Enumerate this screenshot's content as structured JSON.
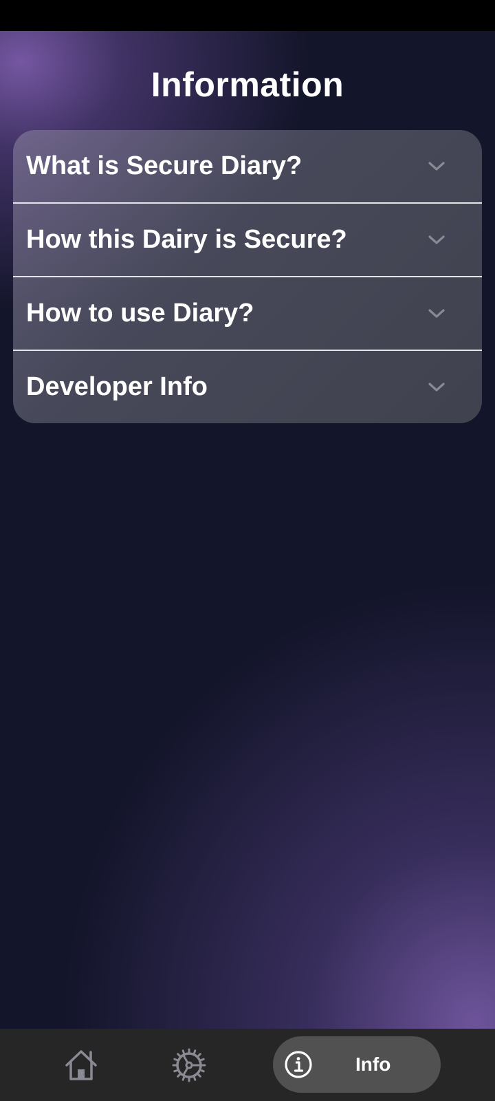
{
  "page": {
    "title": "Information"
  },
  "accordion": {
    "items": [
      {
        "label": "What is Secure Diary?",
        "expanded": false,
        "icon": "chevron-down-icon"
      },
      {
        "label": "How this Dairy is Secure?",
        "expanded": false,
        "icon": "chevron-down-icon"
      },
      {
        "label": "How to use Diary?",
        "expanded": false,
        "icon": "chevron-down-icon"
      },
      {
        "label": "Developer Info",
        "expanded": false,
        "icon": "chevron-down-icon"
      }
    ]
  },
  "bottom_nav": {
    "items": [
      {
        "name": "home",
        "icon": "home-icon",
        "selected": false
      },
      {
        "name": "settings",
        "icon": "gear-icon",
        "selected": false
      },
      {
        "name": "info",
        "icon": "info-icon",
        "label": "Info",
        "selected": true
      }
    ]
  },
  "colors": {
    "background": "#13152a",
    "accent_glow": "#7a5aa8",
    "card": "#424450",
    "divider": "#e6e6ea",
    "nav_bar": "#262626",
    "nav_pill": "#515151",
    "text": "#ffffff",
    "icon_muted": "#8a8a94"
  }
}
